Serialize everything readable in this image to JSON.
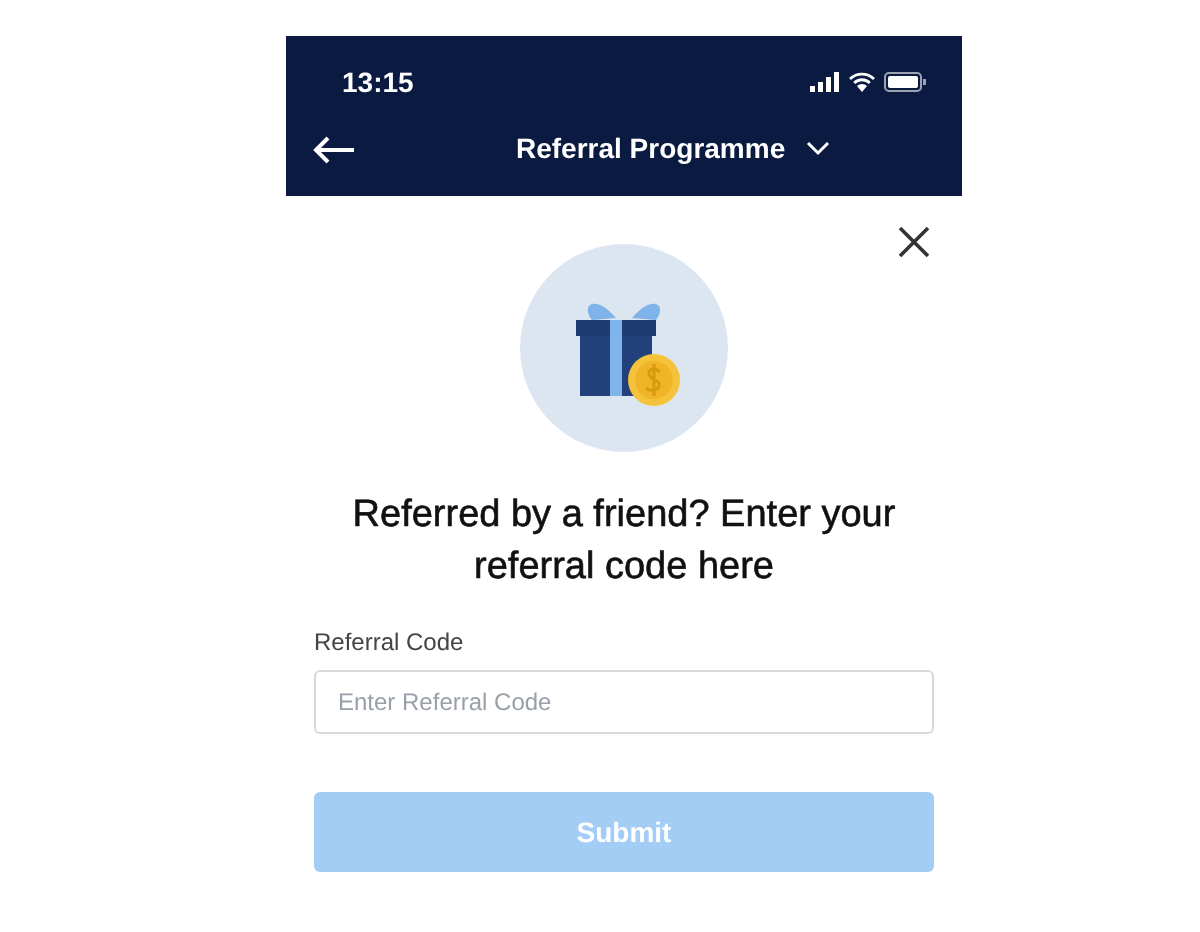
{
  "status_bar": {
    "time": "13:15"
  },
  "nav_bar": {
    "title": "Referral Programme"
  },
  "heading": "Referred by a friend? Enter your referral code here",
  "field": {
    "label": "Referral Code",
    "placeholder": "Enter Referral Code"
  },
  "submit": {
    "label": "Submit",
    "disabled": true
  }
}
